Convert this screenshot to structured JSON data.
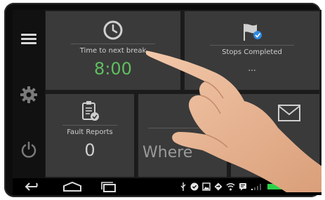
{
  "tiles": {
    "break": {
      "label": "Time to next break",
      "value": "8:00",
      "value_color": "#5fbf5f"
    },
    "stops": {
      "label": "Stops Completed",
      "value": "..."
    },
    "faults": {
      "label": "Fault Reports",
      "value": "0"
    },
    "where": {
      "value": "Where"
    },
    "messages": {}
  },
  "status_bar": {
    "time": "11:47",
    "battery_color": "#2bd24a"
  },
  "icons": {
    "menu": "hamburger-icon",
    "settings": "gear-icon",
    "power": "power-icon",
    "break": "clock-icon",
    "stops": "flag-check-icon",
    "faults": "clipboard-check-icon",
    "messages": "envelope-icon"
  }
}
